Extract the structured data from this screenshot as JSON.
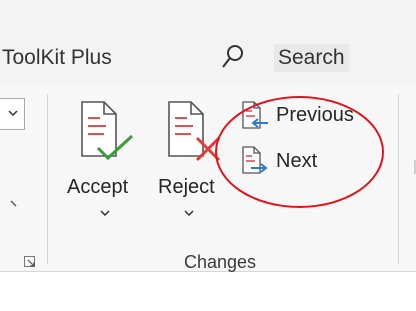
{
  "header": {
    "app_title": "ToolKit Plus",
    "search_icon": "search-icon",
    "search_label": "Search"
  },
  "ribbon": {
    "commands": {
      "accept_label": "Accept",
      "reject_label": "Reject",
      "previous_label": "Previous",
      "next_label": "Next"
    },
    "group_label": "Changes",
    "icons": {
      "accept": "accept-change-icon",
      "reject": "reject-change-icon",
      "previous": "previous-change-icon",
      "next": "next-change-icon",
      "launcher": "dialog-launcher-icon"
    }
  },
  "annotation": {
    "highlight_color": "#e0141a"
  },
  "colors": {
    "accept_check": "#3c9c3c",
    "reject_x": "#e53935",
    "doc_lines": "#e05050",
    "arrow_blue": "#2e7bd6"
  }
}
